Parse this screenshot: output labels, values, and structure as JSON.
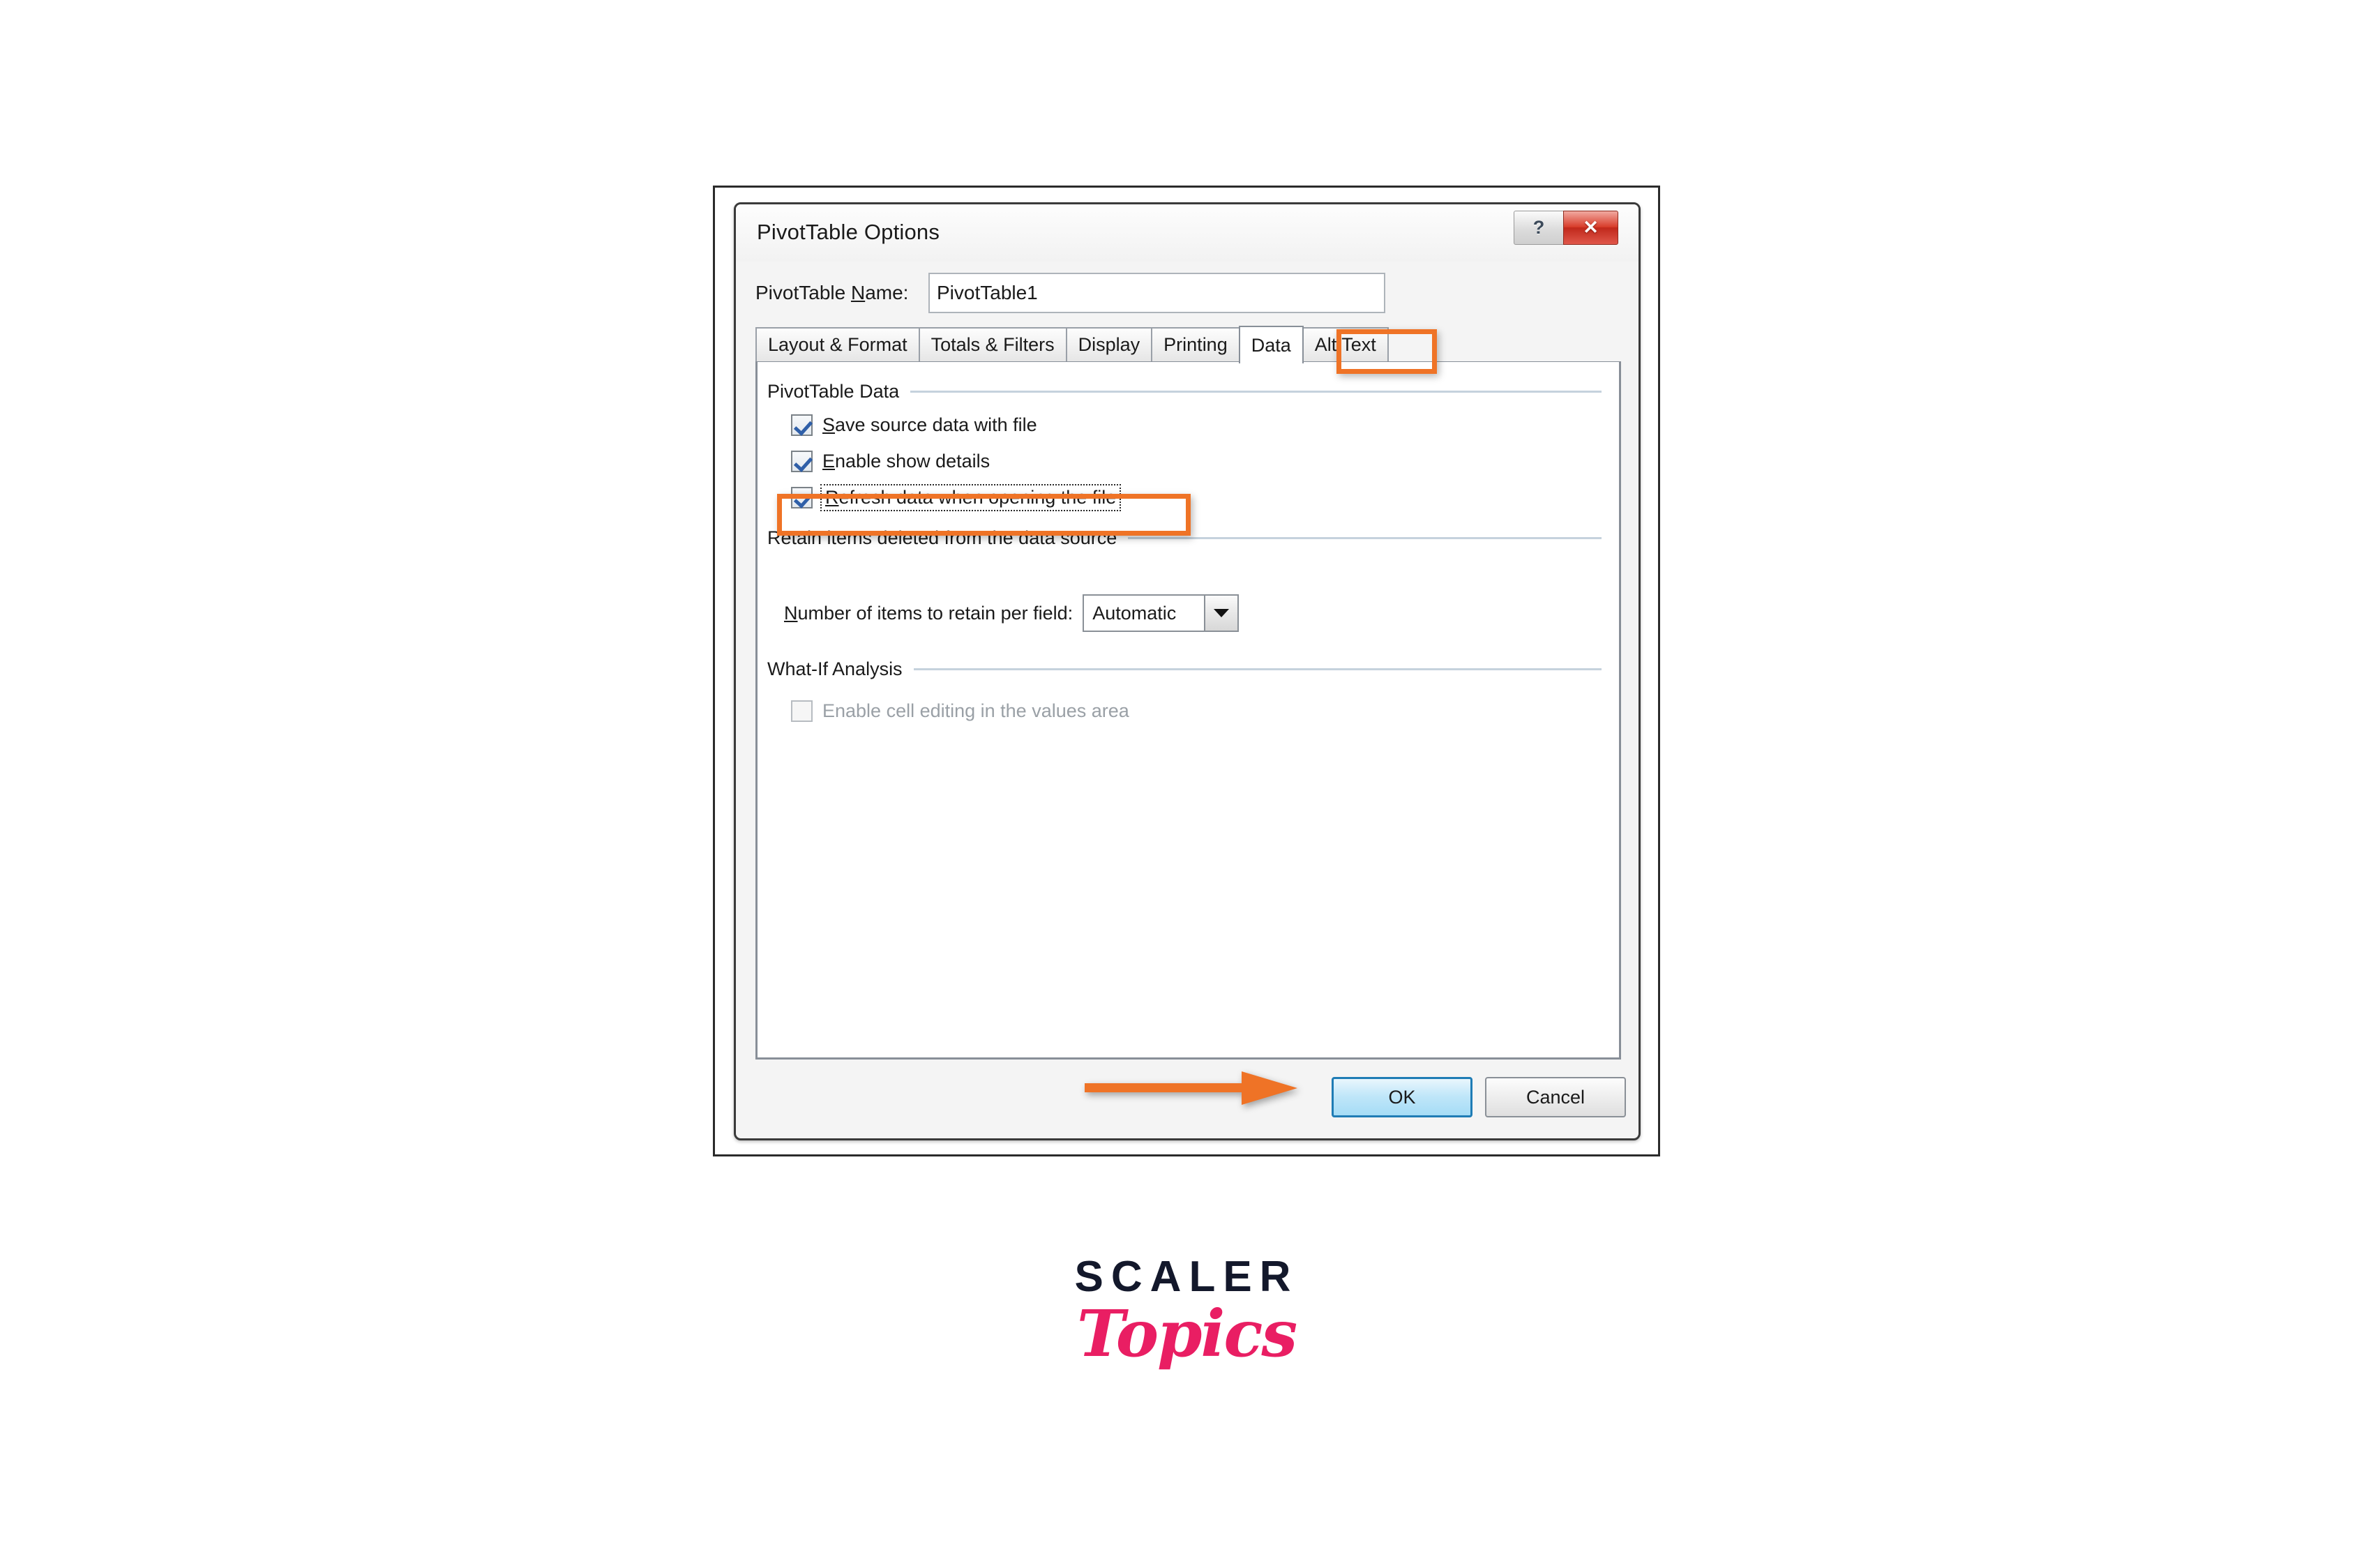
{
  "dialog": {
    "title": "PivotTable Options",
    "help_button": "?",
    "close_button": "✕",
    "name_label": "PivotTable Name:",
    "name_label_accel": "N",
    "name_value": "PivotTable1"
  },
  "tabs": [
    {
      "label": "Layout & Format",
      "selected": false
    },
    {
      "label": "Totals & Filters",
      "selected": false
    },
    {
      "label": "Display",
      "selected": false
    },
    {
      "label": "Printing",
      "selected": false
    },
    {
      "label": "Data",
      "selected": true
    },
    {
      "label": "Alt Text",
      "selected": false
    }
  ],
  "groups": {
    "pivottable_data": {
      "label": "PivotTable Data",
      "checkboxes": [
        {
          "label": "Save source data with file",
          "accel": "S",
          "checked": true,
          "enabled": true,
          "focused": false
        },
        {
          "label": "Enable show details",
          "accel": "E",
          "checked": true,
          "enabled": true,
          "focused": false
        },
        {
          "label": "Refresh data when opening the file",
          "accel": "R",
          "checked": true,
          "enabled": true,
          "focused": true
        }
      ]
    },
    "retain_items": {
      "label": "Retain items deleted from the data source",
      "field_label": "Number of items to retain per field:",
      "field_accel": "N",
      "field_value": "Automatic"
    },
    "what_if": {
      "label": "What-If Analysis",
      "checkboxes": [
        {
          "label": "Enable cell editing in the values area",
          "checked": false,
          "enabled": false
        }
      ]
    }
  },
  "buttons": {
    "ok": "OK",
    "cancel": "Cancel"
  },
  "annotations": {
    "highlight_color": "#ef7326",
    "data_tab_highlight": "Data",
    "refresh_row_highlight": "Refresh data when opening the file",
    "arrow_target": "OK"
  },
  "logo": {
    "primary": "SCALER",
    "secondary": "Topics",
    "primary_color": "#13182b",
    "secondary_color": "#e91e63"
  }
}
